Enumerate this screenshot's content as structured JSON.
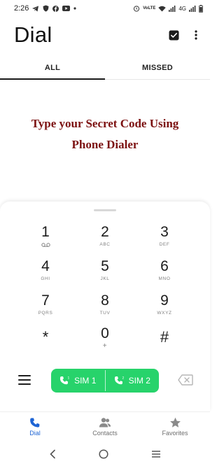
{
  "status_bar": {
    "time": "2:26",
    "network": "4G",
    "volte": "VoLTE"
  },
  "header": {
    "title": "Dial"
  },
  "tabs": [
    {
      "label": "ALL",
      "active": true
    },
    {
      "label": "MISSED",
      "active": false
    }
  ],
  "banner": {
    "line1": "Type your Secret Code Using",
    "line2": "Phone Dialer",
    "color": "#7c1111"
  },
  "keypad": {
    "keys": [
      {
        "digit": "1",
        "sub": "voicemail-icon"
      },
      {
        "digit": "2",
        "sub": "ABC"
      },
      {
        "digit": "3",
        "sub": "DEF"
      },
      {
        "digit": "4",
        "sub": "GHI"
      },
      {
        "digit": "5",
        "sub": "JKL"
      },
      {
        "digit": "6",
        "sub": "MNO"
      },
      {
        "digit": "7",
        "sub": "PQRS"
      },
      {
        "digit": "8",
        "sub": "TUV"
      },
      {
        "digit": "9",
        "sub": "WXYZ"
      },
      {
        "digit": "*",
        "sub": ""
      },
      {
        "digit": "0",
        "sub": "+"
      },
      {
        "digit": "#",
        "sub": ""
      }
    ]
  },
  "sim": {
    "sim1_label": "SIM 1",
    "sim1_slot": "1",
    "sim2_label": "SIM 2",
    "sim2_slot": "2",
    "color": "#27d36b"
  },
  "bottom_nav": [
    {
      "label": "Dial",
      "icon": "phone-icon",
      "active": true
    },
    {
      "label": "Contacts",
      "icon": "contacts-icon",
      "active": false
    },
    {
      "label": "Favorites",
      "icon": "star-icon",
      "active": false
    }
  ],
  "colors": {
    "accent": "#1e64d4",
    "sim_green": "#27d36b"
  }
}
